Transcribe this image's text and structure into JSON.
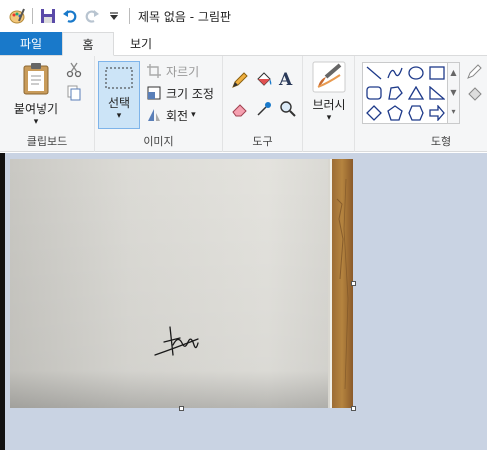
{
  "window": {
    "title": "제목 없음 - 그림판"
  },
  "quick_access": {
    "icons": [
      "paint-app-icon",
      "save-icon",
      "undo-icon",
      "redo-icon",
      "customize-dropdown-icon"
    ]
  },
  "tabs": [
    {
      "label": "파일"
    },
    {
      "label": "홈"
    },
    {
      "label": "보기"
    }
  ],
  "ribbon": {
    "clipboard": {
      "paste_label": "붙여넣기",
      "group_label": "클립보드"
    },
    "image": {
      "select_label": "선택",
      "crop_label": "자르기",
      "resize_label": "크기 조정",
      "rotate_label": "회전",
      "group_label": "이미지"
    },
    "tools": {
      "group_label": "도구"
    },
    "brushes": {
      "label": "브러시"
    },
    "shapes": {
      "group_label": "도형"
    }
  },
  "colors": {
    "file_tab": "#1979ca",
    "ribbon_bg": "#f5f6f7",
    "workspace_bg": "#c9d3e3",
    "select_highlight": "#cce4f7"
  },
  "canvas": {
    "content": "photo-of-paper-with-signature"
  }
}
